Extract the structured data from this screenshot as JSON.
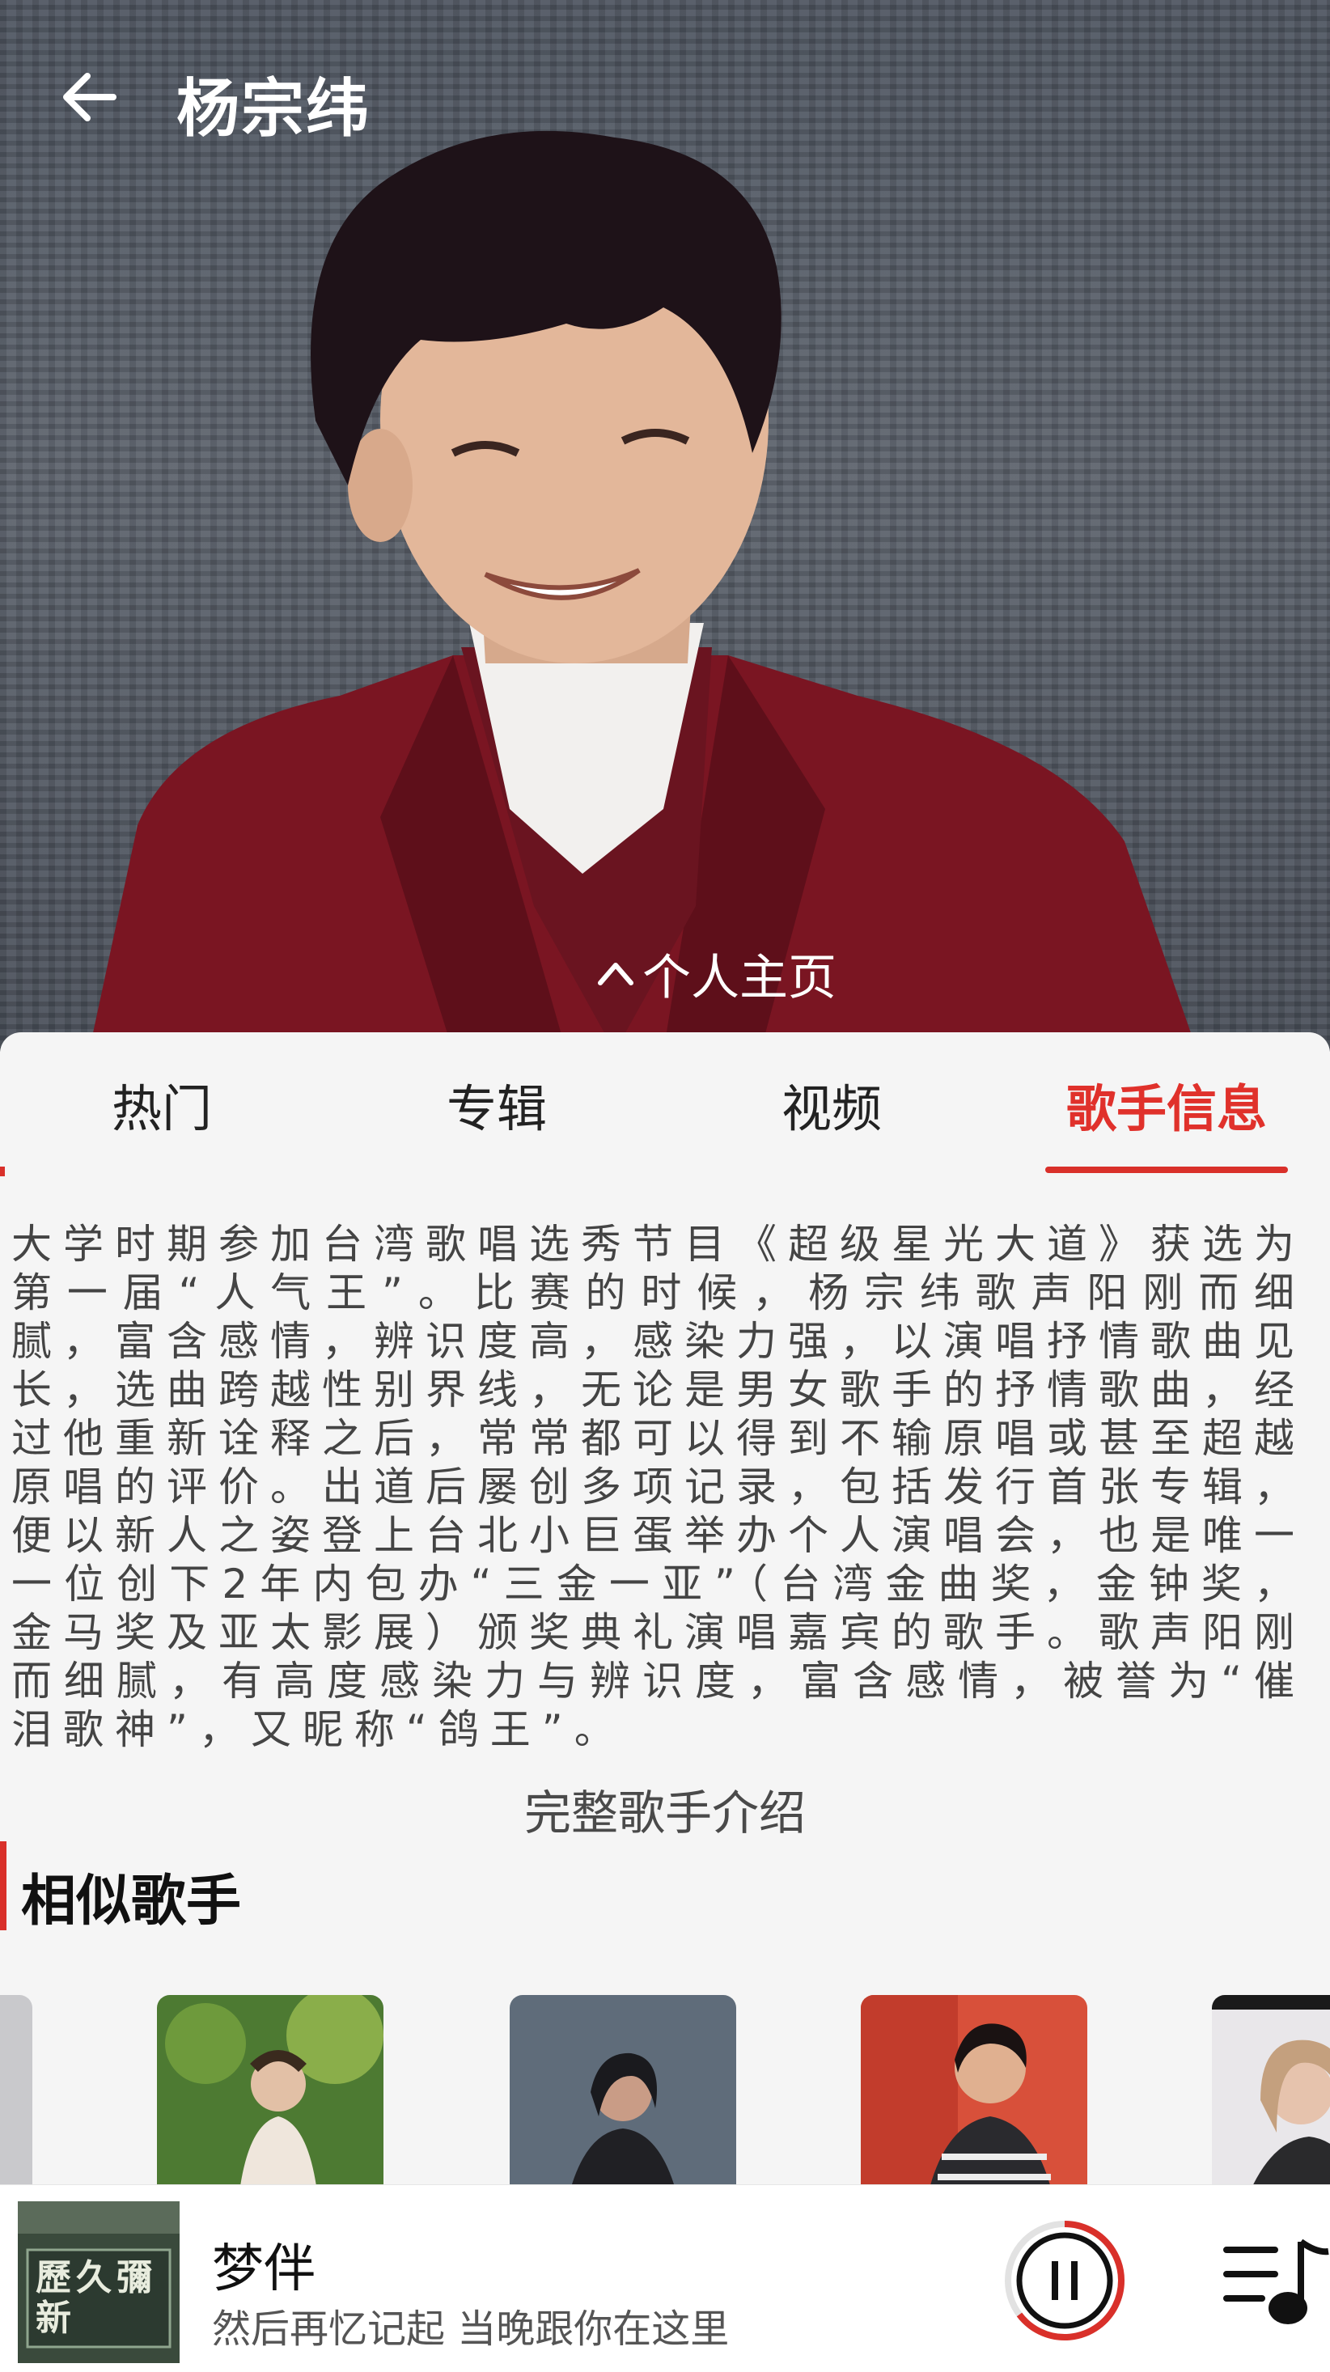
{
  "header": {
    "title": "杨宗纬",
    "profile_link": "个人主页"
  },
  "tabs": [
    {
      "label": "热门"
    },
    {
      "label": "专辑"
    },
    {
      "label": "视频"
    },
    {
      "label": "歌手信息"
    }
  ],
  "active_tab": "歌手信息",
  "bio": "大学时期参加台湾歌唱选秀节目《超级星光大道》获选为第一届“人气王”。比赛的时候，杨宗纬歌声阳刚而细腻，富含感情，辨识度高，感染力强，以演唱抒情歌曲见长，选曲跨越性别界线，无论是男女歌手的抒情歌曲，经过他重新诠释之后，常常都可以得到不输原唱或甚至超越原唱的评价。出道后屡创多项记录，包括发行首张专辑，便以新人之姿登上台北小巨蛋举办个人演唱会，也是唯一一位创下2年内包办“三金一亚”（台湾金曲奖，金钟奖，金马奖及亚太影展）颁奖典礼演唱嘉宾的歌手。歌声阳刚而细腻，有高度感染力与辨识度，富含感情，被誉为“催泪歌神”，又昵称“鸽王”。",
  "full_intro_link": "完整歌手介绍",
  "similar": {
    "title": "相似歌手"
  },
  "player": {
    "song": "梦伴",
    "lyric": "然后再忆记起 当晚跟你在这里",
    "cover_text": "歷久彌新"
  },
  "colors": {
    "accent": "#d9302a",
    "active_tab_text": "#e0312b"
  },
  "icons": {
    "back": "arrow-left-icon",
    "profile": "chevron-up-icon",
    "play": "pause-icon",
    "playlist": "playlist-icon"
  }
}
